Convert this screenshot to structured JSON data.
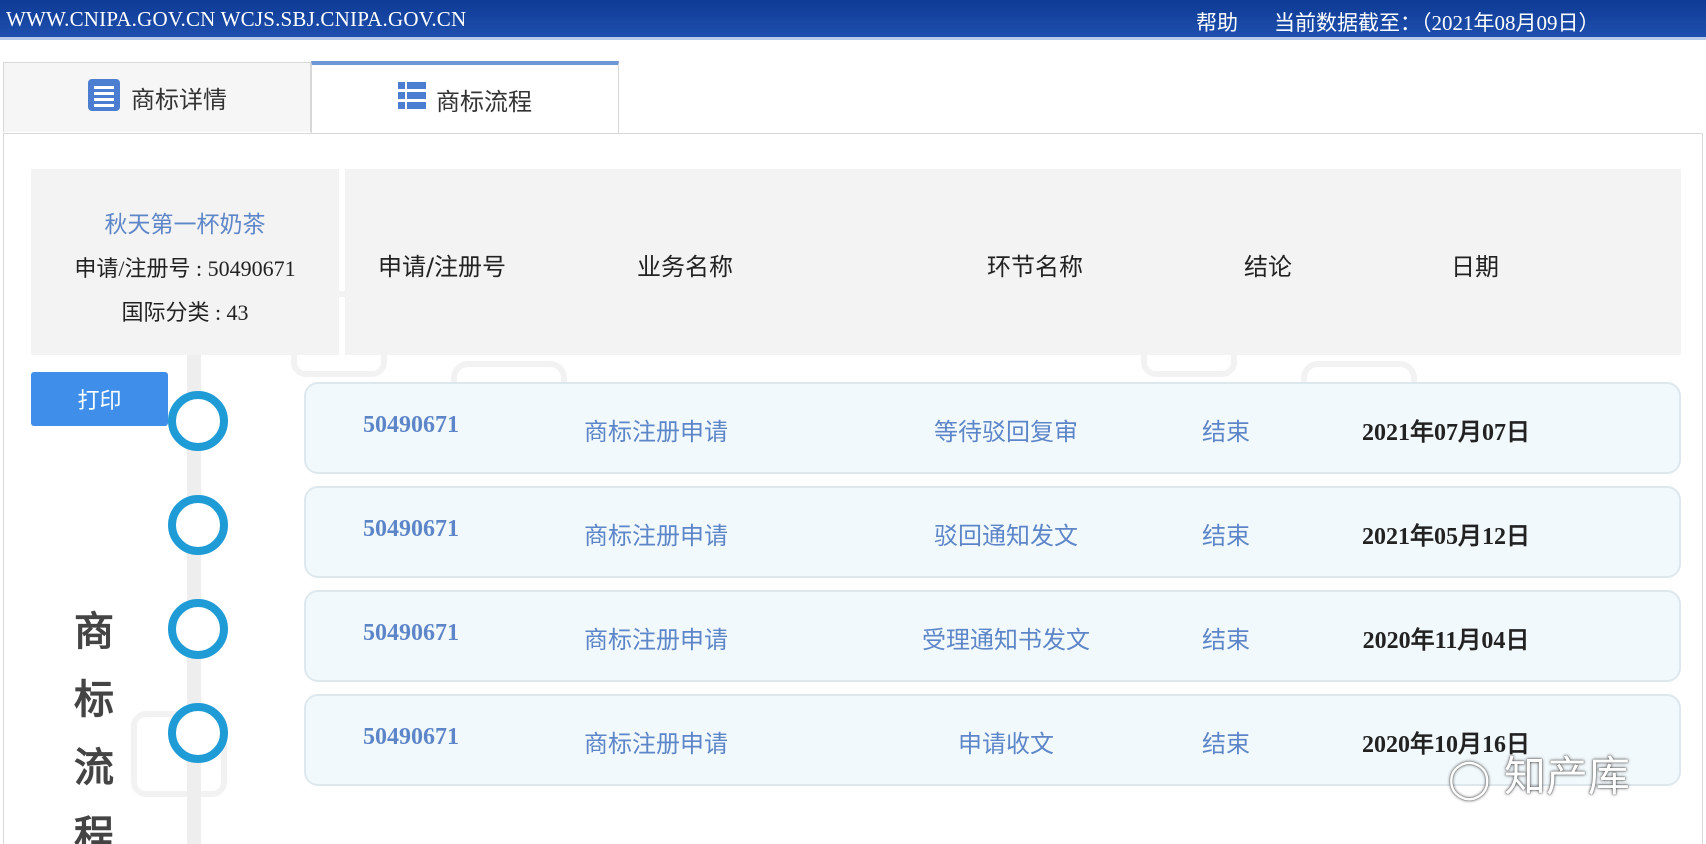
{
  "topbar": {
    "urls": "WWW.CNIPA.GOV.CN WCJS.SBJ.CNIPA.GOV.CN",
    "help": "帮助",
    "data_cutoff": "当前数据截至：（2021年08月09日）"
  },
  "tabs": [
    {
      "label": "商标详情",
      "icon": "document-list-icon",
      "active": false
    },
    {
      "label": "商标流程",
      "icon": "table-list-icon",
      "active": true
    }
  ],
  "trademark": {
    "name": "秋天第一杯奶茶",
    "reg_no_line": "申请/注册号 : 50490671",
    "class_line": "国际分类 : 43"
  },
  "table_headers": {
    "reg_no": "申请/注册号",
    "business": "业务名称",
    "step": "环节名称",
    "result": "结论",
    "date": "日期"
  },
  "print_label": "打印",
  "side_title": [
    "商",
    "标",
    "流",
    "程"
  ],
  "rows": [
    {
      "reg_no": "50490671",
      "business": "商标注册申请",
      "step": "等待驳回复审",
      "result": "结束",
      "date": "2021年07月07日"
    },
    {
      "reg_no": "50490671",
      "business": "商标注册申请",
      "step": "驳回通知发文",
      "result": "结束",
      "date": "2021年05月12日"
    },
    {
      "reg_no": "50490671",
      "business": "商标注册申请",
      "step": "受理通知书发文",
      "result": "结束",
      "date": "2020年11月04日"
    },
    {
      "reg_no": "50490671",
      "business": "商标注册申请",
      "step": "申请收文",
      "result": "结束",
      "date": "2020年10月16日"
    }
  ],
  "watermark_text": "知产库",
  "colors": {
    "accent": "#1f9bd6",
    "link": "#5d86c9",
    "topbar": "#0d3b95",
    "button": "#3f8eea"
  }
}
